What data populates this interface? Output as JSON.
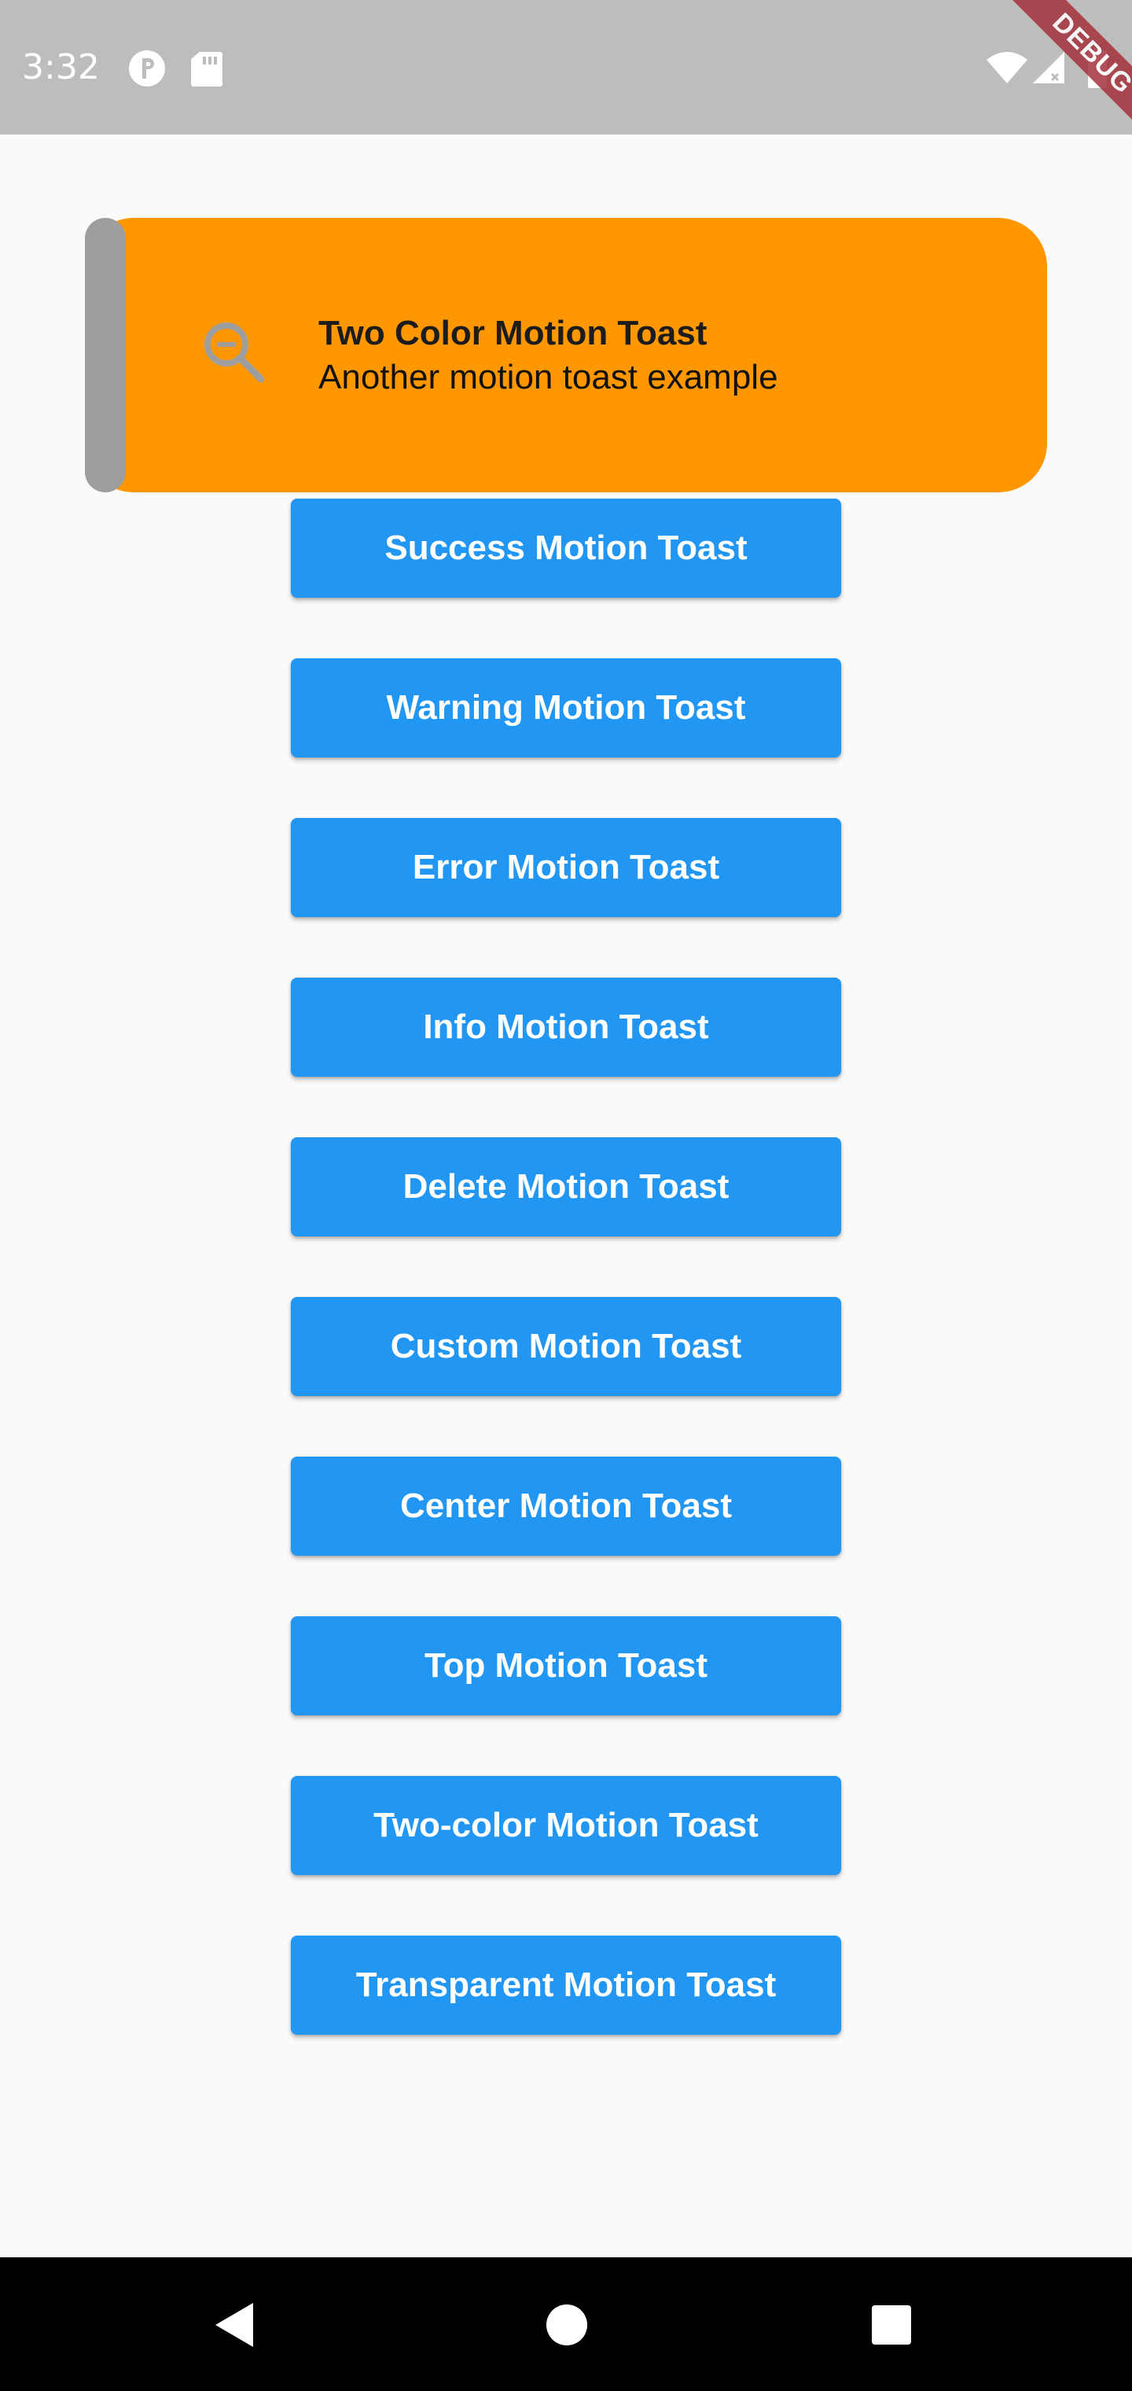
{
  "status_bar": {
    "time": "3:32",
    "icons": [
      "notification-p-icon",
      "sd-card-icon",
      "wifi-icon",
      "signal-icon",
      "battery-icon"
    ],
    "debug_banner": "DEBUG",
    "color": "#bdbdbd"
  },
  "toast": {
    "title": "Two Color Motion Toast",
    "description": "Another motion toast example",
    "icon": "zoom-out-icon",
    "background_color": "#ff9800",
    "side_bar_color": "#9e9e9e"
  },
  "buttons": [
    {
      "label": "Success Motion Toast"
    },
    {
      "label": "Warning Motion Toast"
    },
    {
      "label": "Error Motion Toast"
    },
    {
      "label": "Info Motion Toast"
    },
    {
      "label": "Delete Motion Toast"
    },
    {
      "label": "Custom Motion Toast"
    },
    {
      "label": "Center Motion Toast"
    },
    {
      "label": "Top Motion Toast"
    },
    {
      "label": "Two-color Motion Toast"
    },
    {
      "label": "Transparent Motion Toast"
    }
  ],
  "button_color": "#2196f3",
  "nav_bar": {
    "icons": [
      "back-icon",
      "home-icon",
      "recents-icon"
    ]
  }
}
